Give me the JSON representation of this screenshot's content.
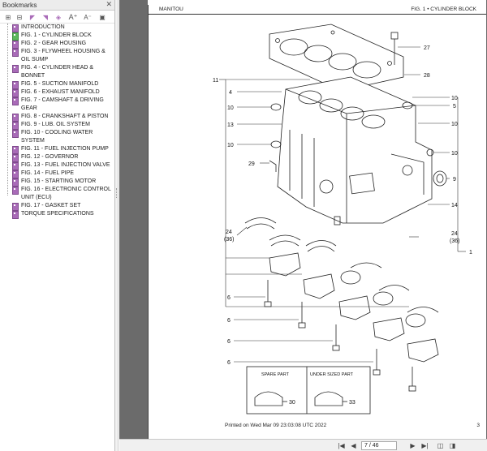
{
  "bookmarks": {
    "title": "Bookmarks",
    "close_glyph": "✕",
    "toolbar": [
      {
        "icon": "expand-all-icon",
        "glyph": "⊞"
      },
      {
        "icon": "collapse-all-icon",
        "glyph": "⊟"
      },
      {
        "icon": "bookmark-prev-icon",
        "glyph": "◤"
      },
      {
        "icon": "bookmark-next-icon",
        "glyph": "◥"
      },
      {
        "icon": "bookmark-goto-icon",
        "glyph": "◈"
      },
      {
        "icon": "font-larger-icon",
        "glyph": "A⁺"
      },
      {
        "icon": "font-smaller-icon",
        "glyph": "A⁻"
      },
      {
        "icon": "bookmark-options-icon",
        "glyph": "▣"
      }
    ],
    "items": [
      "INTRODUCTION",
      "FIG. 1 - CYLINDER BLOCK",
      "FIG. 2 - GEAR HOUSING",
      "FIG. 3 - FLYWHEEL HOUSING & OIL SUMP",
      "FIG. 4 - CYLINDER HEAD & BONNET",
      "FIG. 5 - SUCTION MANIFOLD",
      "FIG. 6 - EXHAUST MANIFOLD",
      "FIG. 7 - CAMSHAFT & DRIVING GEAR",
      "FIG. 8 - CRANKSHAFT & PISTON",
      "FIG. 9 - LUB. OIL SYSTEM",
      "FIG. 10 - COOLING WATER SYSTEM",
      "FIG. 11 - FUEL INJECTION PUMP",
      "FIG. 12 - GOVERNOR",
      "FIG. 13 - FUEL INJECTION VALVE",
      "FIG. 14 - FUEL PIPE",
      "FIG. 15 - STARTING MOTOR",
      "FIG. 16 - ELECTRONIC CONTROL UNIT (ECU)",
      "FIG. 17 - GASKET SET",
      "TORQUE SPECIFICATIONS"
    ],
    "active_index": 1
  },
  "page": {
    "header_left": "MANITOU",
    "header_right": "FIG. 1 • CYLINDER BLOCK",
    "footer_printed": "Printed on  Wed Mar 09 23:03:08 UTC 2022",
    "footer_page": "3",
    "callouts": {
      "c27": "27",
      "c28": "28",
      "c11": "11",
      "c4": "4",
      "c10a": "10",
      "c13": "13",
      "c10b": "10",
      "c29": "29",
      "c10c": "10",
      "c5": "5",
      "c10d": "10",
      "c10e": "10",
      "c9": "9",
      "c14": "14",
      "c24l": "24",
      "c36l": "(36)",
      "c24r": "24",
      "c36r": "(36)",
      "c1": "1",
      "c6a": "6",
      "c6b": "6",
      "c6c": "6",
      "c6d": "6"
    },
    "spare_label": "SPARE PART",
    "under_label": "UNDER SIZED PART",
    "spare_num": "30",
    "under_num": "33"
  },
  "nav": {
    "first_glyph": "|◀",
    "prev_glyph": "◀",
    "page_field": "7 / 46",
    "next_glyph": "▶",
    "last_glyph": "▶|",
    "extra1_glyph": "◫",
    "extra2_glyph": "◨"
  }
}
